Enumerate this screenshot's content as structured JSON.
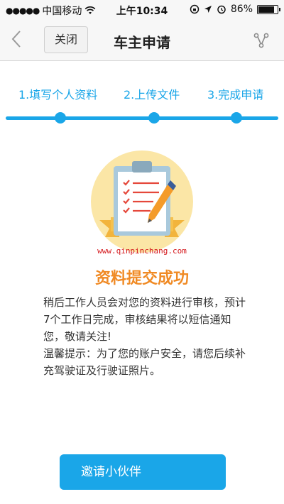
{
  "status_bar": {
    "carrier": "中国移动",
    "time": "上午10:34",
    "battery": "86%",
    "battery_level": 0.86
  },
  "nav": {
    "close_label": "关闭",
    "title": "车主申请"
  },
  "steps": [
    {
      "label": "1.填写个人资料"
    },
    {
      "label": "2.上传文件"
    },
    {
      "label": "3.完成申请"
    }
  ],
  "watermark": "www.qinpinchang.com",
  "success": {
    "title": "资料提交成功",
    "message_1": "稍后工作人员会对您的资料进行审核，预计7个工作日完成，审核结果将以短信通知您，敬请关注!",
    "message_2": "温馨提示：为了您的账户安全，请您后续补充驾驶证及行驶证照片。"
  },
  "invite_button": "邀请小伙伴",
  "colors": {
    "accent": "#1aa6e8",
    "success_title": "#f08a24",
    "watermark": "#d4161b"
  }
}
